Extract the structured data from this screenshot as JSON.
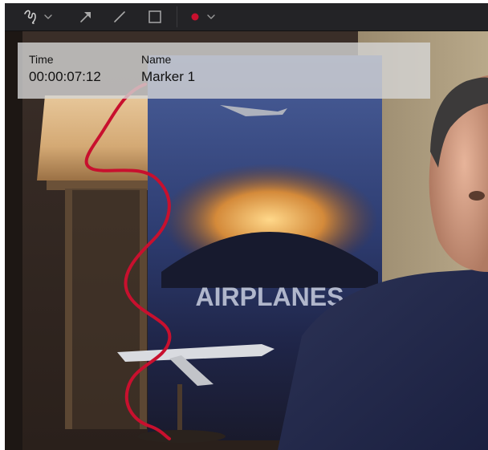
{
  "toolbar": {
    "tools": [
      {
        "name": "freehand-draw-tool",
        "icon": "squiggle-icon",
        "has_dropdown": true
      },
      {
        "name": "arrow-tool",
        "icon": "arrow-icon"
      },
      {
        "name": "line-tool",
        "icon": "line-icon"
      },
      {
        "name": "rectangle-tool",
        "icon": "rectangle-icon"
      }
    ],
    "color_picker": {
      "icon": "color-dot-icon",
      "color": "#c8102e",
      "has_dropdown": true
    }
  },
  "marker": {
    "time_header": "Time",
    "time_value": "00:00:07:12",
    "name_header": "Name",
    "name_value": "Marker 1"
  },
  "poster": {
    "title": "AIRPLANES"
  },
  "annotation": {
    "stroke_color": "#c8102e"
  }
}
